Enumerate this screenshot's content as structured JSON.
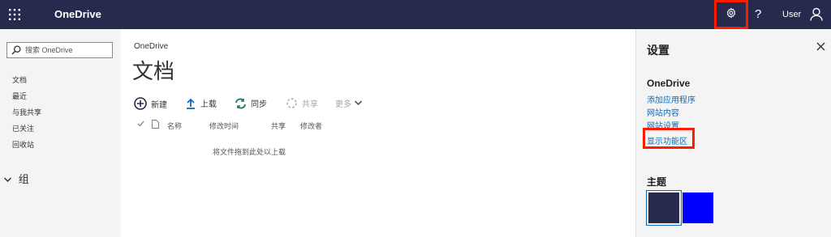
{
  "topbar": {
    "app_name": "OneDrive",
    "help_label": "?",
    "user_label": "User",
    "background": "#262a4d"
  },
  "sidebar": {
    "search_placeholder": "搜索 OneDrive",
    "items": [
      {
        "label": "文档"
      },
      {
        "label": "最近"
      },
      {
        "label": "与我共享"
      },
      {
        "label": "已关注"
      },
      {
        "label": "回收站"
      }
    ],
    "groups_label": "组"
  },
  "main": {
    "breadcrumb": "OneDrive",
    "title": "文档",
    "commands": {
      "new": "新建",
      "upload": "上载",
      "sync": "同步",
      "share": "共享",
      "more": "更多"
    },
    "columns": {
      "name": "名称",
      "modified": "修改时间",
      "shared": "共享",
      "modified_by": "修改者"
    },
    "empty_message": "将文件拖到此处以上载"
  },
  "settings_panel": {
    "title": "设置",
    "section_title": "OneDrive",
    "links": {
      "add_app": "添加应用程序",
      "site_contents": "网站内容",
      "site_settings": "网站设置",
      "show_ribbon": "显示功能区"
    },
    "theme_title": "主题",
    "themes": [
      {
        "color": "#262a4d",
        "selected": true
      },
      {
        "color": "#0000ff",
        "selected": false
      }
    ]
  },
  "colors": {
    "accent": "#0f6cbd",
    "highlight": "#ff1a00",
    "sync_icon": "#1b7a6e"
  }
}
